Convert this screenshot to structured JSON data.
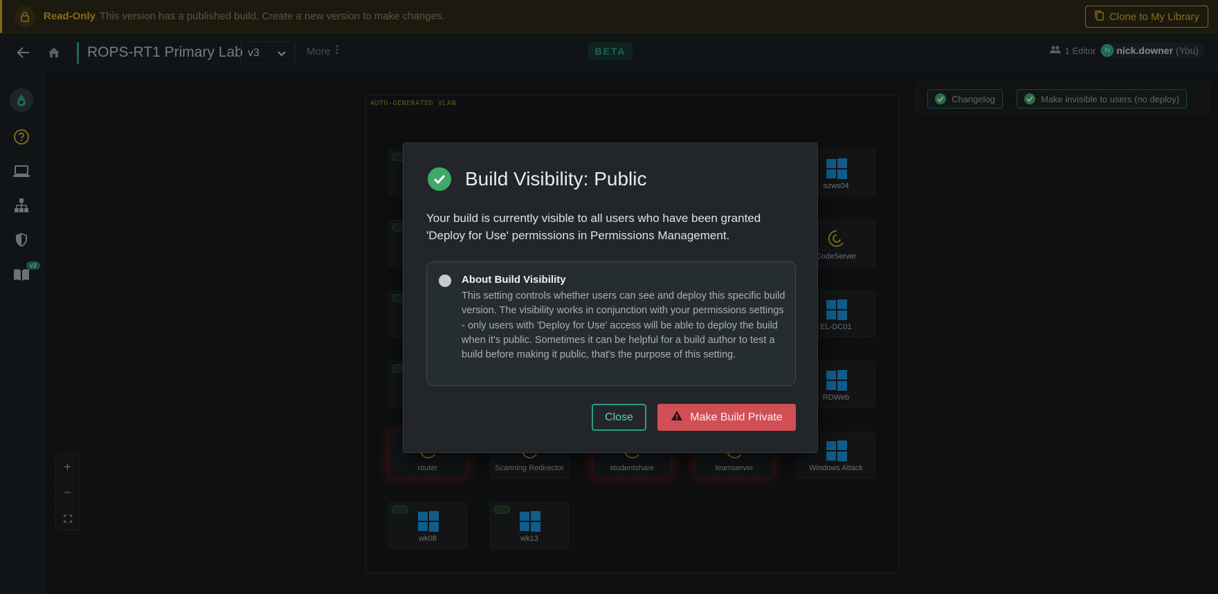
{
  "banner": {
    "label": "Read-Only",
    "message": "This version has a published build. Create a new version to make changes.",
    "clone_label": "Clone to My Library",
    "accent_color": "#c9a22a"
  },
  "header": {
    "title": "ROPS-RT1 Primary Lab",
    "version": "v3",
    "more_label": "More",
    "beta_label": "BETA",
    "editors_count": "1 Editor",
    "user_initial": "N",
    "user_name": "nick.downer",
    "user_suffix": "(You)"
  },
  "sidebar": {
    "badge": "v3",
    "icons": [
      "logo-icon",
      "help-icon",
      "laptop-icon",
      "network-icon",
      "shield-icon",
      "book-icon"
    ]
  },
  "canvas": {
    "vlan_label": "AUTO-GENERATED VLAN",
    "toolbar": {
      "changelog_label": "Changelog",
      "invisible_label": "Make invisible to users (no deploy)"
    },
    "nodes": [
      {
        "label": "azws04",
        "icon": "windows-icon"
      },
      {
        "label": "CodeServer",
        "icon": "debian-icon"
      },
      {
        "label": "EL-DC01",
        "icon": "windows-icon"
      },
      {
        "label": "RDWeb",
        "icon": "windows-icon"
      },
      {
        "label": "router",
        "icon": "debian-icon"
      },
      {
        "label": "Scanning Redirector",
        "icon": "debian-icon"
      },
      {
        "label": "studentshare",
        "icon": "debian-icon"
      },
      {
        "label": "teamserver",
        "icon": "debian-icon"
      },
      {
        "label": "Windows Attack",
        "icon": "windows-icon"
      },
      {
        "label": "wk08",
        "icon": "windows-icon"
      },
      {
        "label": "wk13",
        "icon": "windows-icon"
      }
    ],
    "zoom": {
      "in": "+",
      "out": "−"
    }
  },
  "modal": {
    "title": "Build Visibility: Public",
    "description": "Your build is currently visible to all users who have been granted 'Deploy for Use' permissions in Permissions Management.",
    "info_title": "About Build Visibility",
    "info_body": "This setting controls whether users can see and deploy this specific build version. The visibility works in conjunction with your permissions settings - only users with 'Deploy for Use' access will be able to deploy the build when it's public. Sometimes it can be helpful for a build author to test a build before making it public, that's the purpose of this setting.",
    "close_label": "Close",
    "private_label": "Make Build Private",
    "success_color": "#3fa86a",
    "danger_color": "#d04f55"
  }
}
